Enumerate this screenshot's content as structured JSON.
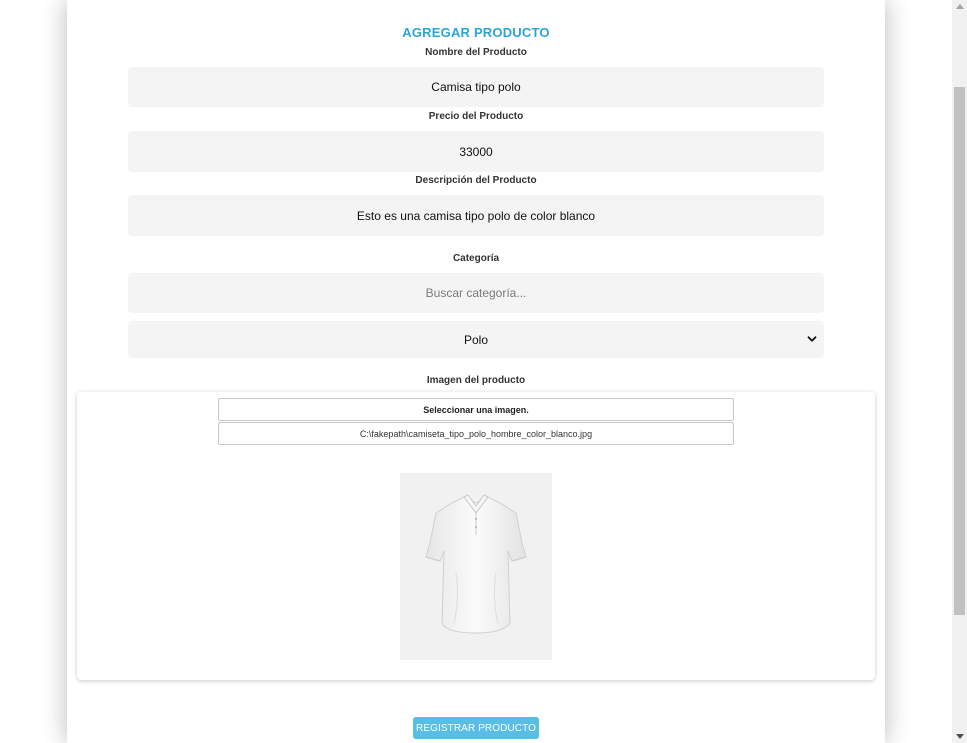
{
  "form": {
    "title": "AGREGAR PRODUCTO",
    "name_label": "Nombre del Producto",
    "name_value": "Camisa tipo polo",
    "price_label": "Precio del Producto",
    "price_value": "33000",
    "description_label": "Descripción del Producto",
    "description_value": "Esto es una camisa tipo polo de color blanco",
    "category_label": "Categoría",
    "category_search_placeholder": "Buscar categoría...",
    "category_selected": "Polo",
    "image_label": "Imagen del producto",
    "select_image_label": "Seleccionar una imagen.",
    "file_path": "C:\\fakepath\\camiseta_tipo_polo_hombre_color_blanco.jpg",
    "submit_label": "REGISTRAR PRODUCTO"
  },
  "icons": {
    "select_chevron": "chevron-down-icon",
    "product_image": "white-polo-shirt"
  },
  "colors": {
    "title": "#2aa5d6",
    "submit_button": "#59bde6",
    "field_background": "#f4f4f4"
  }
}
